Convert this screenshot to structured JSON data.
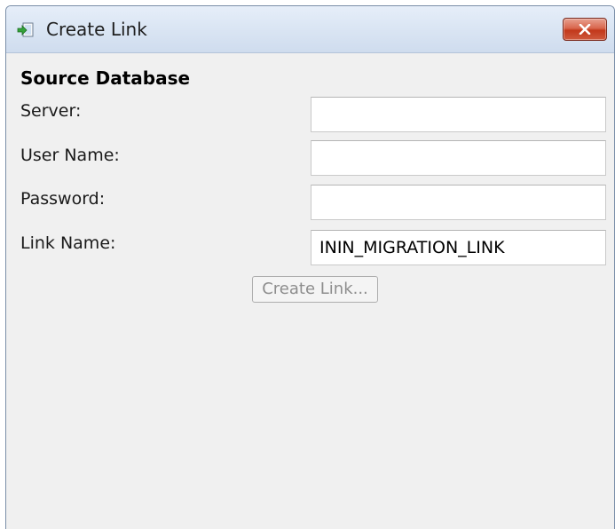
{
  "window": {
    "title": "Create Link",
    "icon": "link-arrow-icon",
    "close_icon": "close-icon"
  },
  "form": {
    "section_title": "Source Database",
    "fields": [
      {
        "label": "Server:",
        "value": ""
      },
      {
        "label": "User Name:",
        "value": ""
      },
      {
        "label": "Password:",
        "value": ""
      },
      {
        "label": "Link Name:",
        "value": "ININ_MIGRATION_LINK"
      }
    ],
    "create_button_label": "Create Link...",
    "create_button_enabled": false
  }
}
